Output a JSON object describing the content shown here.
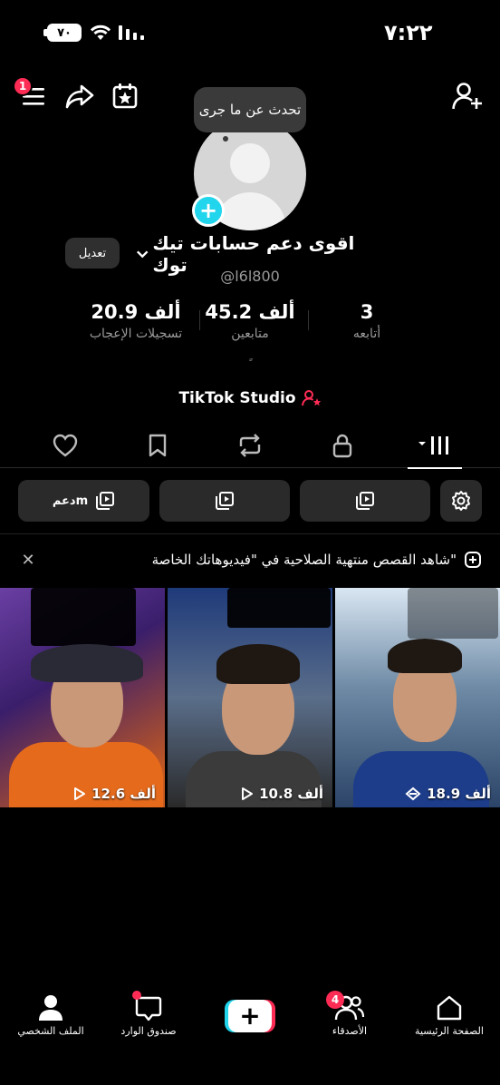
{
  "status_bar": {
    "time": "٧:٢٢",
    "battery": "٧٠"
  },
  "top_bar": {
    "menu_badge": "1"
  },
  "profile": {
    "bubble_text": "تحدث عن ما جرى",
    "name": "اقوى دعم حسابات تيك توك",
    "handle": "@l6l800",
    "edit_label": "تعديل"
  },
  "stats": {
    "likes": {
      "value": "20.9 ألف",
      "label": "تسجيلات الإعجاب"
    },
    "followers": {
      "value": "45.2 ألف",
      "label": "متابعين"
    },
    "following": {
      "value": "3",
      "label": "أتابعه"
    },
    "small_mark": "ٍ"
  },
  "studio": {
    "label": "TikTok Studio"
  },
  "filters": {
    "first_label": "دعمm"
  },
  "notice": {
    "text": "شاهد القصص منتهية الصلاحية في \"فيديوهاتك الخاصة\""
  },
  "videos": [
    {
      "views": "12.6 ألف"
    },
    {
      "views": "10.8 ألف"
    },
    {
      "views": "18.9 ألف"
    }
  ],
  "bottom_nav": {
    "profile": "الملف الشخصي",
    "inbox": "صندوق الوارد",
    "friends": "الأصدقاء",
    "friends_badge": "4",
    "home": "الصفحة الرئيسية"
  },
  "colors": {
    "accent_red": "#fe2c55",
    "accent_cyan": "#20d5ec"
  }
}
